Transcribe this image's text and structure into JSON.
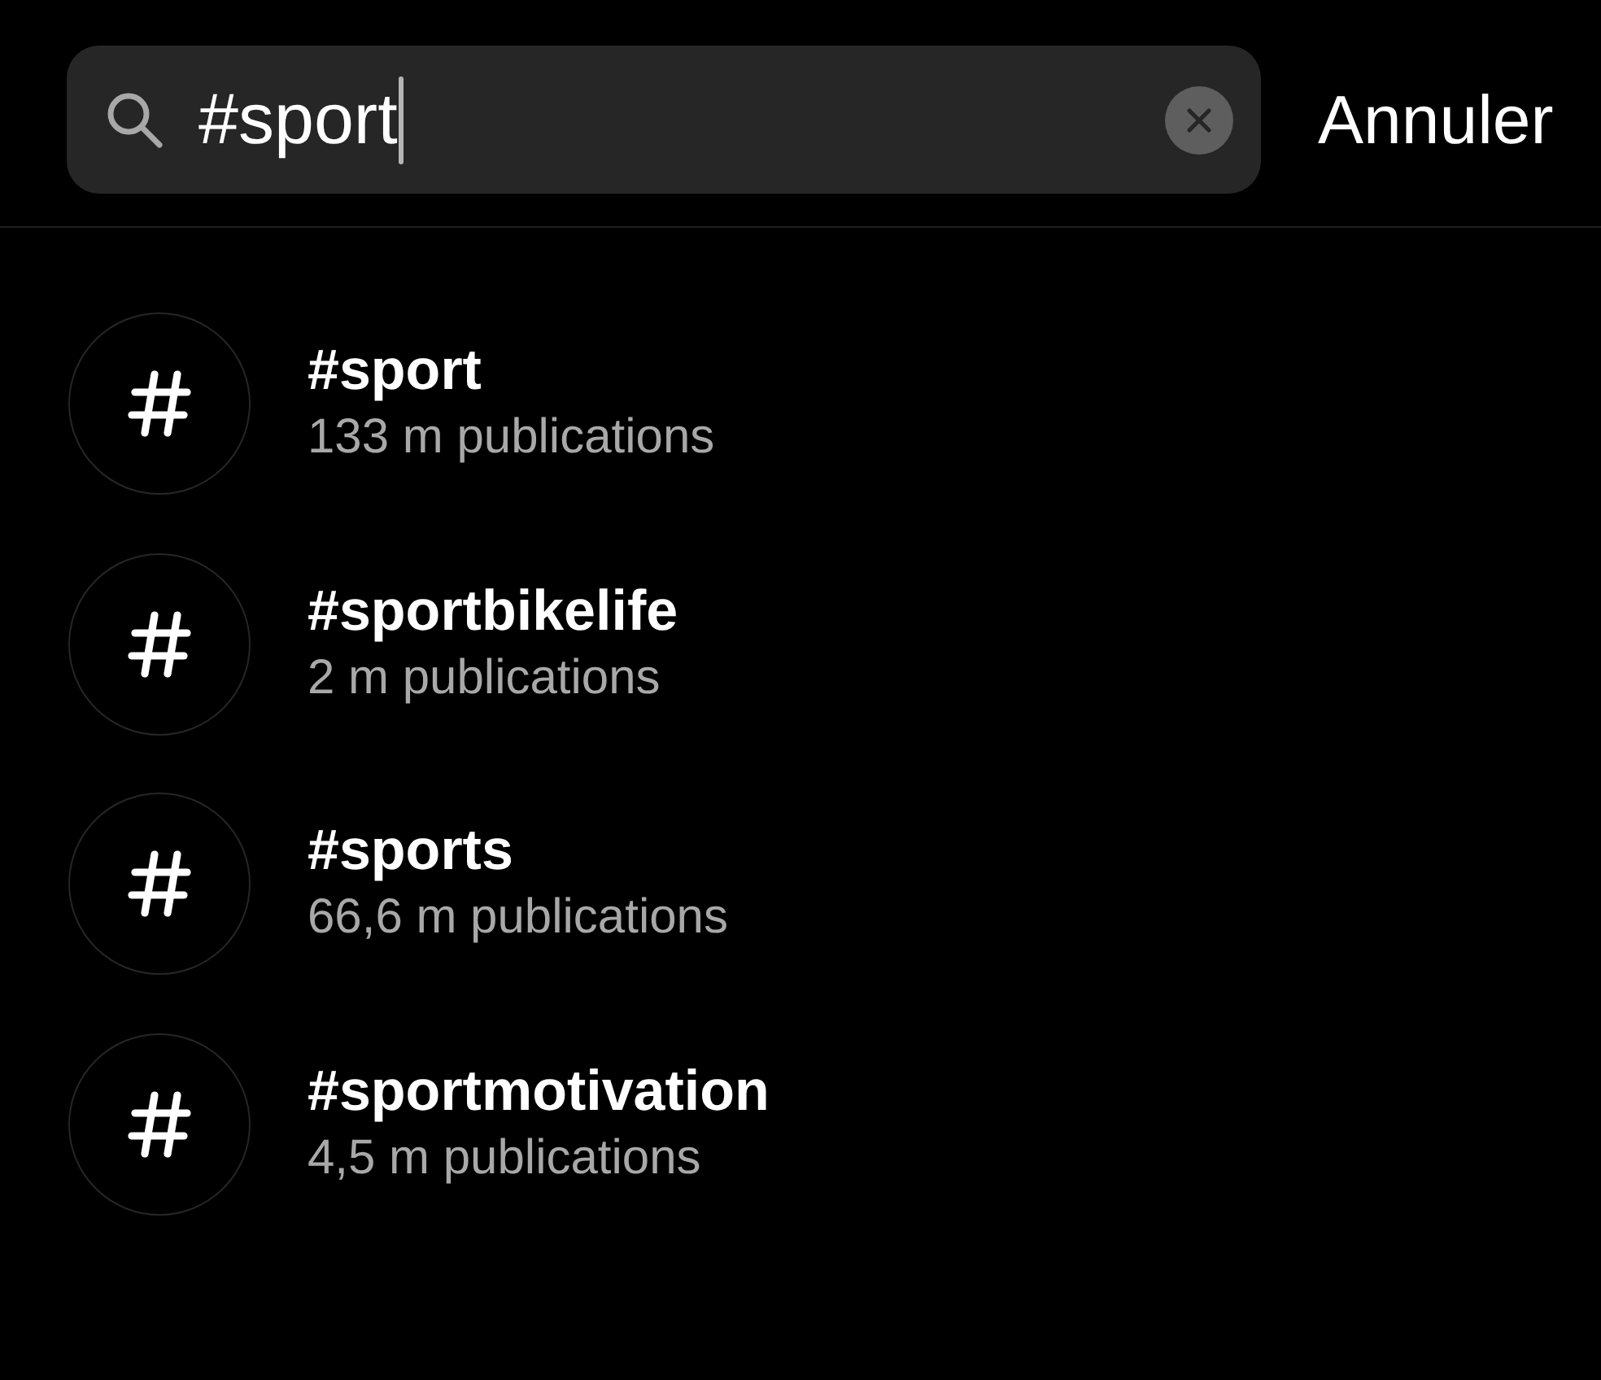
{
  "search": {
    "value": "#sport",
    "focused": true
  },
  "cancel_button": {
    "label": "Annuler"
  },
  "results": [
    {
      "title": "#sport",
      "subtitle": "133 m publications"
    },
    {
      "title": "#sportbikelife",
      "subtitle": "2 m publications"
    },
    {
      "title": "#sports",
      "subtitle": "66,6 m publications"
    },
    {
      "title": "#sportmotivation",
      "subtitle": "4,5 m publications"
    }
  ]
}
